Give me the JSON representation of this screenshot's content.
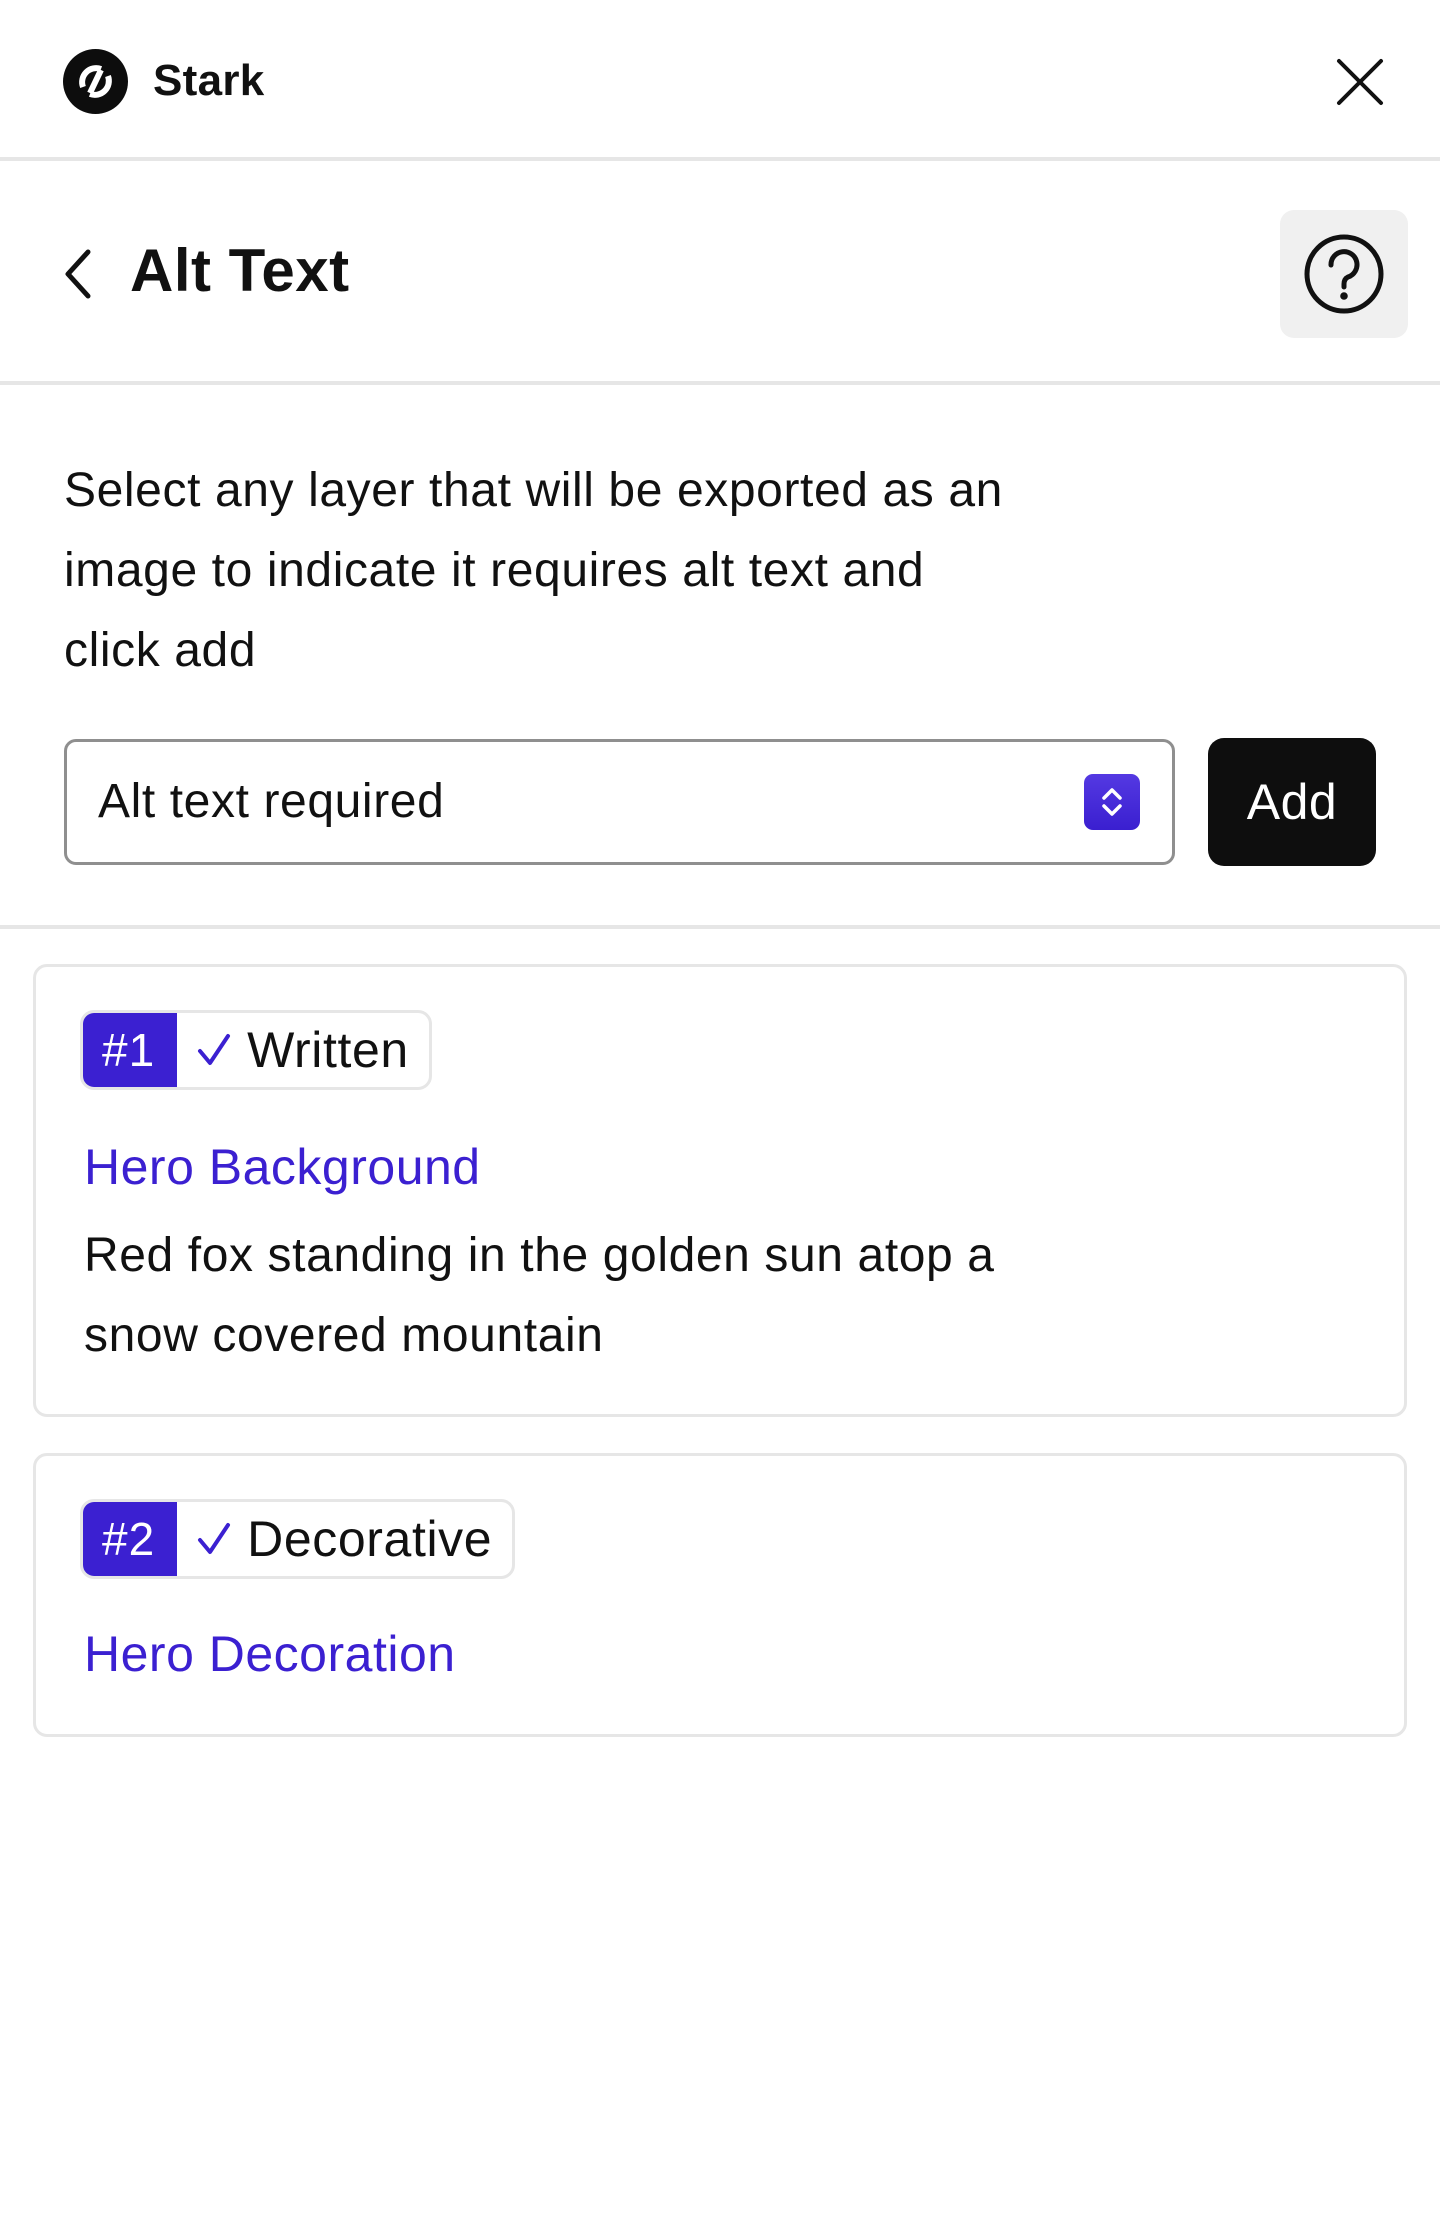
{
  "app": {
    "name": "Stark",
    "logo_icon": "stark-logo-icon",
    "close_icon": "close-icon"
  },
  "header": {
    "title": "Alt Text",
    "back_icon": "chevron-left-icon",
    "help_icon": "question-circle-icon"
  },
  "intro": {
    "description": "Select any layer that will be exported as an image to indicate it requires alt text and click add"
  },
  "controls": {
    "select_value": "Alt text required",
    "select_icon": "up-down-stepper-icon",
    "add_label": "Add"
  },
  "colors": {
    "accent": "#3b20d1",
    "primary_button": "#0e0e0e",
    "border": "#e6e6e6",
    "select_border": "#8f8f8f",
    "help_bg": "#f0f0f0"
  },
  "items": [
    {
      "number": "#1",
      "status_icon": "checkmark-icon",
      "status": "Written",
      "layer": "Hero Background",
      "alt_text": "Red fox standing in the golden sun atop a snow covered mountain"
    },
    {
      "number": "#2",
      "status_icon": "checkmark-icon",
      "status": "Decorative",
      "layer": "Hero Decoration",
      "alt_text": ""
    }
  ]
}
